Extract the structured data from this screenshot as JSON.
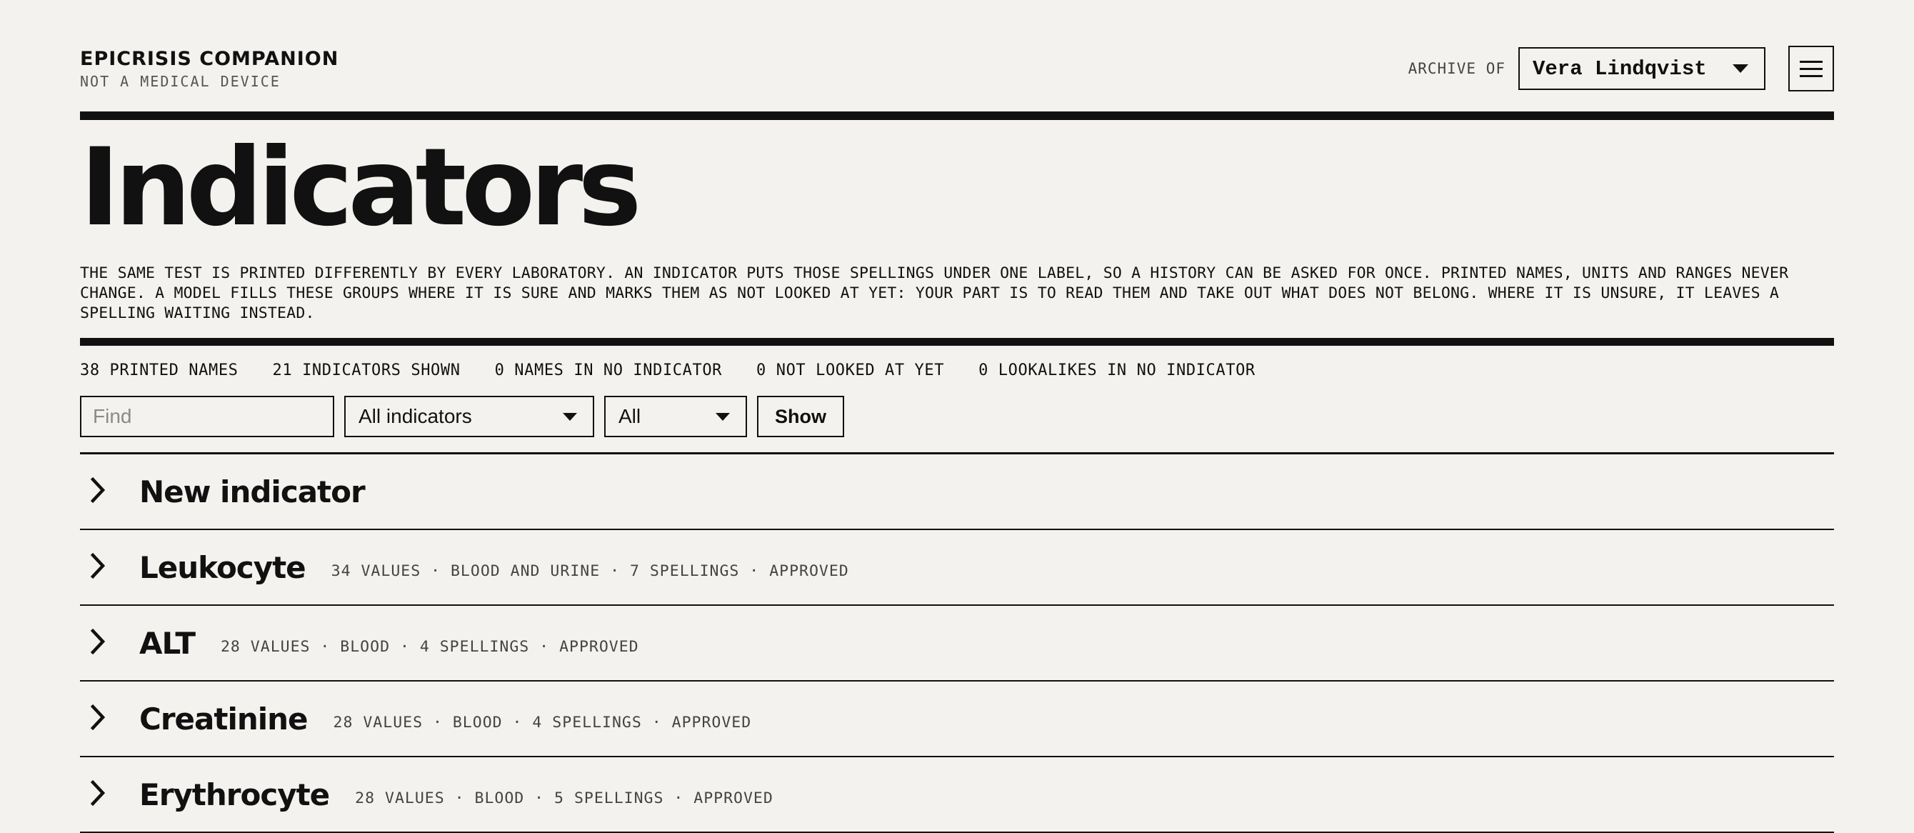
{
  "brand": {
    "name": "EPICRISIS COMPANION",
    "subtitle": "NOT A MEDICAL DEVICE"
  },
  "archive": {
    "label": "ARCHIVE OF",
    "selected_person": "Vera Lindqvist"
  },
  "page_title": "Indicators",
  "intro": "THE SAME TEST IS PRINTED DIFFERENTLY BY EVERY LABORATORY. AN INDICATOR PUTS THOSE SPELLINGS UNDER ONE LABEL, SO A HISTORY CAN BE ASKED FOR ONCE. PRINTED NAMES, UNITS AND RANGES NEVER CHANGE. A MODEL FILLS THESE GROUPS WHERE IT IS SURE AND MARKS THEM AS NOT LOOKED AT YET: YOUR PART IS TO READ THEM AND TAKE OUT WHAT DOES NOT BELONG. WHERE IT IS UNSURE, IT LEAVES A SPELLING WAITING INSTEAD.",
  "stats": [
    "38 PRINTED NAMES",
    "21 INDICATORS SHOWN",
    "0 NAMES IN NO INDICATOR",
    "0 NOT LOOKED AT YET",
    "0 LOOKALIKES IN NO INDICATOR"
  ],
  "filters": {
    "find_placeholder": "Find",
    "find_value": "",
    "indicator_select": "All indicators",
    "status_select": "All",
    "show_label": "Show"
  },
  "rows": [
    {
      "name": "New indicator",
      "meta": ""
    },
    {
      "name": "Leukocyte",
      "meta": "34 VALUES · BLOOD AND URINE · 7 SPELLINGS · APPROVED"
    },
    {
      "name": "ALT",
      "meta": "28 VALUES · BLOOD · 4 SPELLINGS · APPROVED"
    },
    {
      "name": "Creatinine",
      "meta": "28 VALUES · BLOOD · 4 SPELLINGS · APPROVED"
    },
    {
      "name": "Erythrocyte",
      "meta": "28 VALUES · BLOOD · 5 SPELLINGS · APPROVED"
    }
  ],
  "icons": {
    "dropdown": "chevron-down-icon",
    "menu": "menu-icon",
    "row_toggle": "chevron-right-icon"
  }
}
